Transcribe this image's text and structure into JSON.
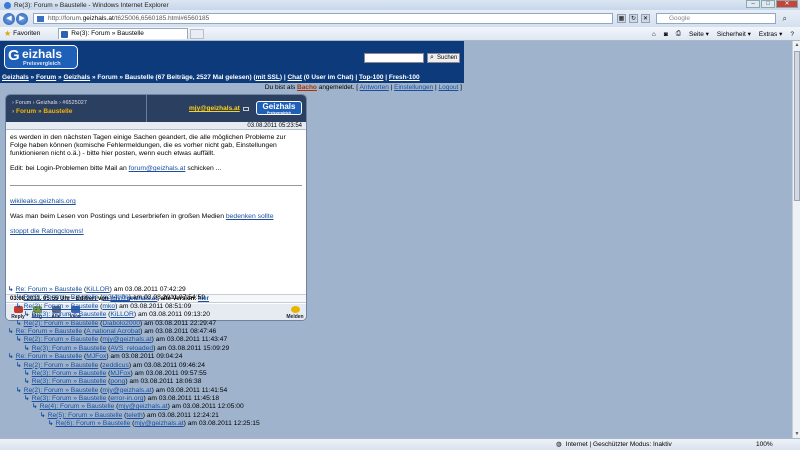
{
  "window": {
    "title": "Re(3): Forum » Baustelle - Windows Internet Explorer"
  },
  "address": {
    "url_prefix": "http://forum.",
    "url_domain": "geizhals.at",
    "url_rest": "/t625006,6560185.html#6560185",
    "search_placeholder": "Google"
  },
  "favbar": {
    "favorites": "Favoriten",
    "tab_title": "Re(3): Forum » Baustelle",
    "cmd_page": "Seite ▾",
    "cmd_security": "Sicherheit ▾",
    "cmd_extras": "Extras ▾"
  },
  "site": {
    "logo_letter": "G",
    "logo_text": "eizhals",
    "logo_sub": "Preisvergleich",
    "search_button": "Suchen",
    "breadcrumb": {
      "part1": "Geizhals",
      "part2": "Forum",
      "part3": "Geizhals",
      "part4": "Forum » Baustelle (67 Beiträge, 2527 Mal gelesen)",
      "ssl": "mit SSL",
      "chat": "Chat",
      "chat_rest": "(0 User im Chat)",
      "top": "Top-100",
      "fresh": "Fresh-100"
    },
    "user_line": {
      "prefix": "Du bist als",
      "nick": "Bacho",
      "middle": "angemeldet.",
      "answer": "Antworten",
      "settings": "Einstellungen",
      "logout": "Logout"
    }
  },
  "post": {
    "crumb": "› Forum › Geizhals › #6525027",
    "title": "› Forum » Baustelle",
    "author": "mjy@geizhals.at",
    "badge": "Geizhals",
    "badge_sub": "Preisvergleich",
    "date": "03.08.2011 05:23:54",
    "p1": "es werden in den nächsten Tagen einige Sachen geandert, die alle möglichen Probleme zur Folge haben können (komische Fehlermeldungen, die es vorher nicht gab, Einstellungen funktionieren nicht o.ä.) - bitte hier posten, wenn euch etwas auffällt.",
    "p2_prefix": "Edit: bei Login-Problemen bitte Mail an",
    "p2_link": "forum@geizhals.at",
    "p2_suffix": "schicken ...",
    "link_wikileaks": "wikileaks.geizhals.org",
    "p3_prefix": "Was man beim Lesen von Postings und Leserbriefen in großen Medien",
    "p3_link": "bedenken sollte",
    "link_stoppt": "stoppt die Ratingclowns!",
    "edit_prefix": "03.08.2011, 05:55 Uhr - Editiert von",
    "edit_user": "mjy@geizhals.at",
    "edit_mid": ", alte Version:",
    "edit_link": "hier",
    "actions": {
      "reply": "Reply",
      "msg": "Msg",
      "alle": "Alle",
      "view": "View",
      "melden": "Melden"
    }
  },
  "thread": [
    {
      "title": "Re: Forum » Baustelle",
      "user": "KiLLOR",
      "date": "am 03.08.2011 07:42:29"
    },
    {
      "title": "Re(2): Forum » Baustelle",
      "user": "m3t4tr0n",
      "date": "am 03.08.2011 07:54:59"
    },
    {
      "title": "Re(2): Forum » Baustelle",
      "user": "mko",
      "date": "am 03.08.2011 08:51:09"
    },
    {
      "title": "Re(3): Forum » Baustelle",
      "user": "KiLLOR",
      "date": "am 03.08.2011 09:13:20"
    },
    {
      "title": "Re(2): Forum » Baustelle",
      "user": "Diabolo2000",
      "date": "am 03.08.2011 22:29:47"
    },
    {
      "title": "Re: Forum » Baustelle",
      "user": "A national Acrobat",
      "date": "am 03.08.2011 08:47:46"
    },
    {
      "title": "Re(2): Forum » Baustelle",
      "user": "mjy@geizhals.at",
      "date": "am 03.08.2011 11:43:47"
    },
    {
      "title": "Re(3): Forum » Baustelle",
      "user": "AVS_reloaded",
      "date": "am 03.08.2011 15:09:29"
    },
    {
      "title": "Re: Forum » Baustelle",
      "user": "MJFox",
      "date": "am 03.08.2011 09:04:24"
    },
    {
      "title": "Re(2): Forum » Baustelle",
      "user": "zeddicus",
      "date": "am 03.08.2011 09:46:24"
    },
    {
      "title": "Re(3): Forum » Baustelle",
      "user": "MJFox",
      "date": "am 03.08.2011 09:57:55"
    },
    {
      "title": "Re(3): Forum » Baustelle",
      "user": "pong",
      "date": "am 03.08.2011 18:06:38"
    },
    {
      "title": "Re(2): Forum » Baustelle",
      "user": "mjy@geizhals.at",
      "date": "am 03.08.2011 11:41:54"
    },
    {
      "title": "Re(3): Forum » Baustelle",
      "user": "error-in.org",
      "date": "am 03.08.2011 11:45:18"
    },
    {
      "title": "Re(4): Forum » Baustelle",
      "user": "mjy@geizhals.at",
      "date": "am 03.08.2011 12:05:00"
    },
    {
      "title": "Re(5): Forum » Baustelle",
      "user": "teleth",
      "date": "am 03.08.2011 12:24:21"
    },
    {
      "title": "Re(6): Forum » Baustelle",
      "user": "mjy@geizhals.at",
      "date": "am 03.08.2011 12:25:15"
    }
  ],
  "status": {
    "zone": "Internet | Geschützter Modus: Inaktiv",
    "zoom": "100%"
  }
}
